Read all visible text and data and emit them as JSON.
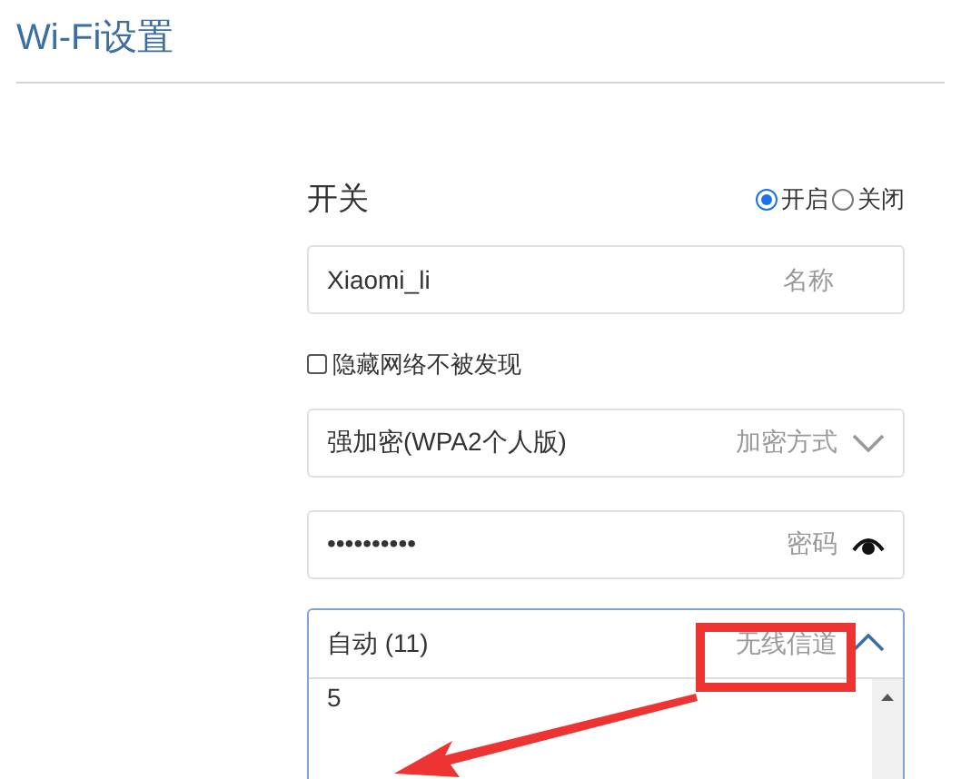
{
  "title": "Wi-Fi设置",
  "switch": {
    "label": "开关",
    "options": [
      {
        "label": "开启",
        "selected": true
      },
      {
        "label": "关闭",
        "selected": false
      }
    ]
  },
  "name_field": {
    "value": "Xiaomi_li",
    "placeholder": "名称"
  },
  "hide_network": {
    "label": "隐藏网络不被发现",
    "checked": false
  },
  "encryption": {
    "value": "强加密(WPA2个人版)",
    "placeholder": "加密方式",
    "expanded": false
  },
  "password": {
    "value": "••••••••••",
    "placeholder": "密码"
  },
  "channel": {
    "value": "自动 (11)",
    "placeholder": "无线信道",
    "expanded": true,
    "options": [
      "5"
    ]
  }
}
